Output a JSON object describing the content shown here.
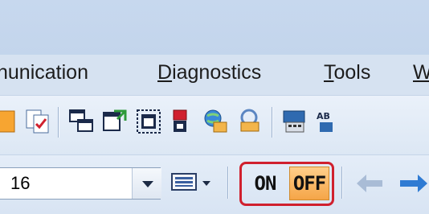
{
  "menu": {
    "items": [
      {
        "label": "nunication",
        "accel": ""
      },
      {
        "label_pre": "",
        "accel": "D",
        "label_post": "iagnostics"
      },
      {
        "label_pre": "",
        "accel": "T",
        "label_post": "ools"
      },
      {
        "label_pre": "",
        "accel": "W",
        "label_post": ""
      }
    ]
  },
  "toolbar2": {
    "zoom_value": "16",
    "on_label": "ON",
    "off_label": "OFF"
  },
  "icons": {
    "toolbar1": [
      "partial-icon",
      "compare-checked-icon",
      "window-arrange-icon",
      "window-restore-icon",
      "window-select-icon",
      "device-red-icon",
      "network-globe-icon",
      "folder-refresh-icon",
      "device-memory-icon",
      "abc-text-icon"
    ],
    "toolbar2": [
      "keyboard-icon",
      "back-arrow-icon",
      "forward-arrow-icon"
    ]
  },
  "colors": {
    "highlight_frame": "#d0202e",
    "off_active": "#f5a548",
    "arrow_disabled": "#a9bcd6",
    "arrow_enabled": "#2f7bd3"
  }
}
